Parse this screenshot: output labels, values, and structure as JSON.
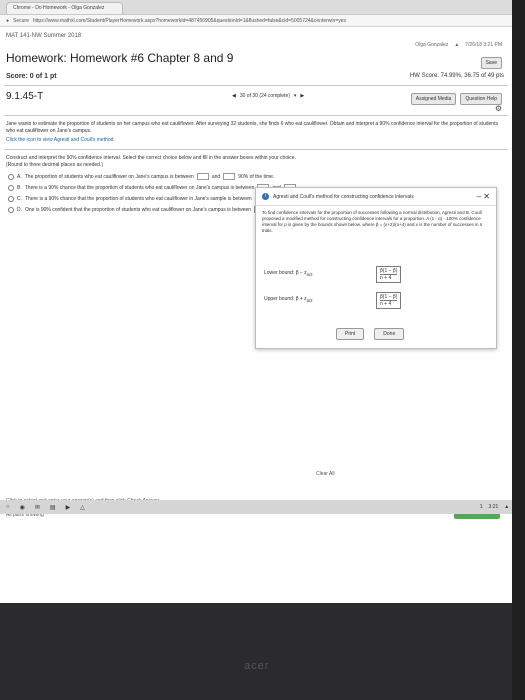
{
  "browser": {
    "tab_title": "Chrome - Do Homework - Olga Gonzalez",
    "secure_label": "Secure",
    "url": "https://www.mathxl.com/Student/PlayerHomework.aspx?homeworkId=487456905&questionId=1&flushed=false&cid=5005724&centerwin=yes"
  },
  "page": {
    "course": "MAT 141-NW Summer 2018",
    "user": "Olga Gonzalez",
    "date": "7/26/18 3:21 PM",
    "title": "Homework: Homework #6 Chapter 8 and 9",
    "save": "Save",
    "score": "Score: 0 of 1 pt",
    "hw_score": "HW Score: 74.99%, 36.75 of 49 pts",
    "question_number": "9.1.45-T",
    "question_nav": "30 of 30 (24 complete)",
    "assigned_media": "Assigned Media",
    "question_help": "Question Help",
    "prompt": "Jane wants to estimate the proportion of students on her campus who eat cauliflower. After surveying 32 students, she finds 6 who eat cauliflower. Obtain and interpret a 90% confidence interval for the proportion of students who eat cauliflower on Jane's campus.",
    "hint": "Click the icon to view Agresti and Coull's method.",
    "instruction1": "Construct and interpret the 90% confidence interval. Select the correct choice below and fill in the answer boxes within your choice.",
    "instruction2": "(Round to three decimal places as needed.)",
    "options": [
      {
        "letter": "A.",
        "text": "The proportion of students who eat cauliflower on Jane's campus is between",
        "mid": "and",
        "end": "90% of the time."
      },
      {
        "letter": "B.",
        "text": "There is a 90% chance that the proportion of students who eat cauliflower on Jane's campus is between",
        "mid": "and",
        "end": ""
      },
      {
        "letter": "C.",
        "text": "There is a 90% chance that the proportion of students who eat cauliflower in Jane's sample is between",
        "mid": "and",
        "end": ""
      },
      {
        "letter": "D.",
        "text": "One is 90% confident that the proportion of students who eat cauliflower on Jane's campus is between",
        "mid": "and",
        "end": ""
      }
    ],
    "dialog": {
      "title": "Agresti and Coull's method for constructing confidence intervals",
      "body": "To find confidence intervals for the proportion of successes following a normal distribution, Agresti and B. Coull proposed a modified method for constructing confidence intervals for a proportion. A (1 - α) · 100% confidence interval for p is given by the bounds shown below, where p̃ = (x+2)/(n+4) and x is the number of successes in n trials.",
      "lower": "Lower bound: p̃ − z",
      "upper": "Upper bound: p̃ + z",
      "alpha": "α/2",
      "frac_top": "p̃(1 − p̃)",
      "frac_bottom": "n + 4",
      "print": "Print",
      "done": "Done"
    },
    "clear_all": "Clear All",
    "enter_instruction": "Click to select and enter your answer(s) and then click Check Answer.",
    "all_parts": "All parts showing",
    "check_answer": "Check Answer"
  },
  "shelf": {
    "status": "1",
    "time": "3:21"
  },
  "device": {
    "brand": "acer"
  }
}
